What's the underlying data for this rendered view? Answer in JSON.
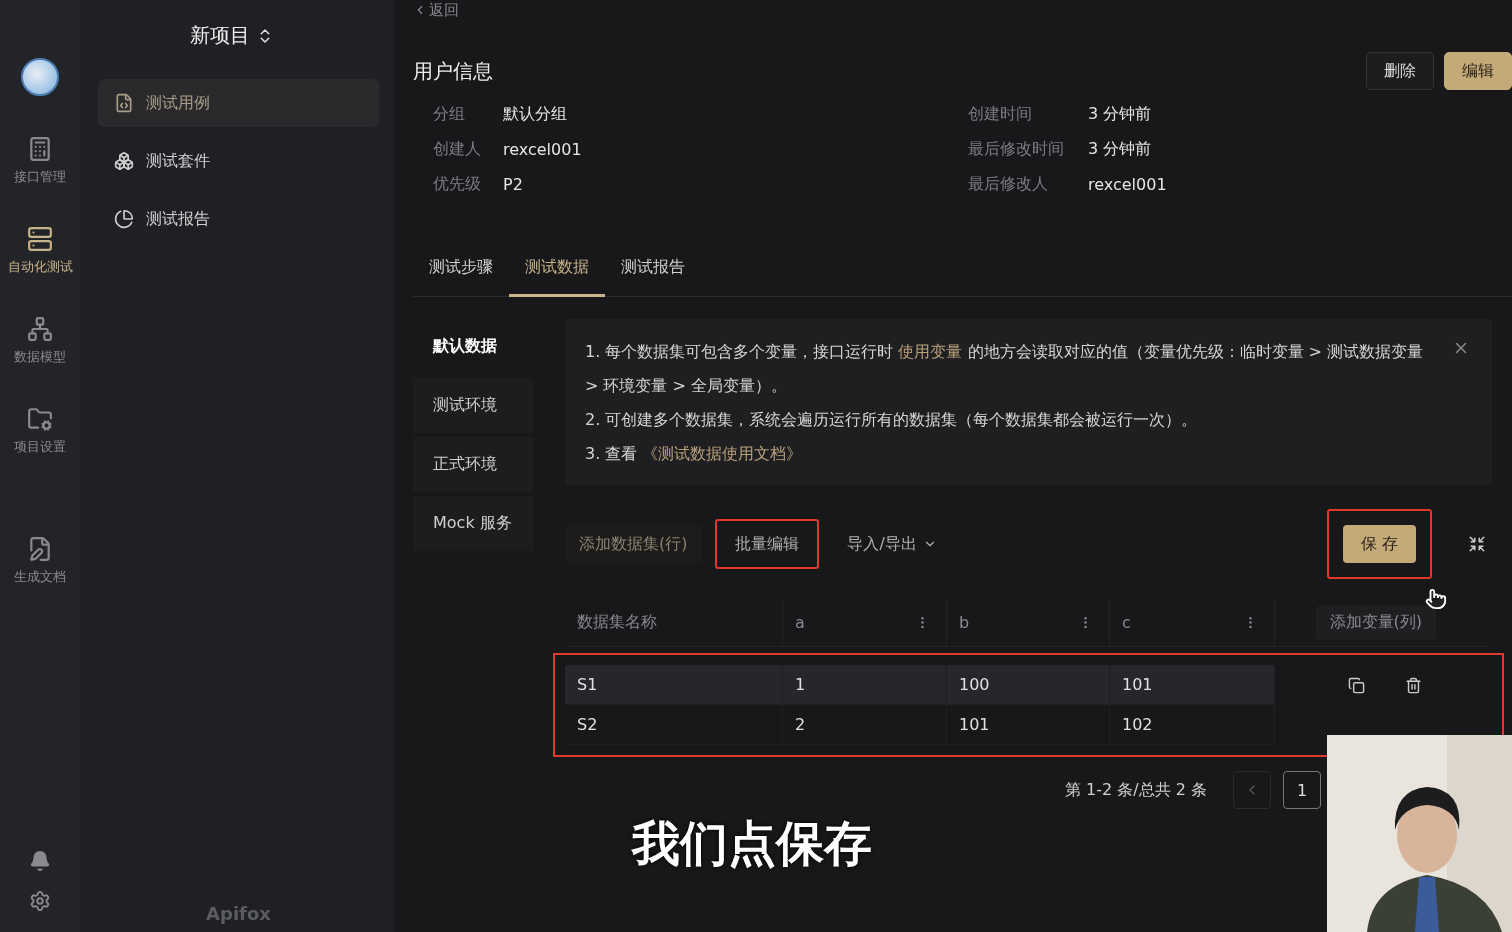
{
  "project": {
    "name": "新项目"
  },
  "rail": [
    {
      "label": "接口管理",
      "selected": false
    },
    {
      "label": "自动化测试",
      "selected": true
    },
    {
      "label": "数据模型",
      "selected": false
    },
    {
      "label": "项目设置",
      "selected": false
    },
    {
      "label": "生成文档",
      "selected": false
    }
  ],
  "nav": [
    {
      "label": "测试用例",
      "selected": true
    },
    {
      "label": "测试套件",
      "selected": false
    },
    {
      "label": "测试报告",
      "selected": false
    }
  ],
  "brand": "Apifox",
  "back": "返回",
  "title": "用户信息",
  "actions": [
    {
      "label": "删除",
      "kind": "secondary"
    },
    {
      "label": "编辑",
      "kind": "primary"
    }
  ],
  "meta_left": [
    {
      "label": "分组",
      "value": "默认分组"
    },
    {
      "label": "创建人",
      "value": "rexcel001"
    },
    {
      "label": "优先级",
      "value": "P2"
    }
  ],
  "meta_right": [
    {
      "label": "创建时间",
      "value": "3 分钟前"
    },
    {
      "label": "最后修改时间",
      "value": "3 分钟前"
    },
    {
      "label": "最后修改人",
      "value": "rexcel001"
    }
  ],
  "tabs": [
    {
      "label": "测试步骤",
      "selected": false
    },
    {
      "label": "测试数据",
      "selected": true
    },
    {
      "label": "测试报告",
      "selected": false
    }
  ],
  "env_tabs": [
    {
      "label": "默认数据",
      "selected": true
    },
    {
      "label": "测试环境",
      "selected": false
    },
    {
      "label": "正式环境",
      "selected": false
    },
    {
      "label": "Mock 服务",
      "selected": false
    }
  ],
  "notice": [
    [
      {
        "kind": "text",
        "text": "1. 每个数据集可包含多个变量，接口运行时 "
      },
      {
        "kind": "link",
        "text": "使用变量"
      },
      {
        "kind": "text",
        "text": " 的地方会读取对应的值（变量优先级：临时变量 > 测试数据变量 > 环境变量 > 全局变量）。"
      }
    ],
    [
      {
        "kind": "text",
        "text": "2. 可创建多个数据集，系统会遍历运行所有的数据集（每个数据集都会被运行一次）。"
      }
    ],
    [
      {
        "kind": "text",
        "text": "3. 查看 "
      },
      {
        "kind": "link",
        "text": "《测试数据使用文档》"
      }
    ]
  ],
  "toolbar": {
    "add_row": "添加数据集(行)",
    "batch_edit": {
      "label": "批量编辑",
      "highlighted": true
    },
    "import_export": "导入/导出",
    "save": {
      "label": "保 存",
      "highlighted": true
    }
  },
  "table": {
    "name_column": "数据集名称",
    "columns": [
      "a",
      "b",
      "c"
    ],
    "add_column": "添加变量(列)",
    "rows_highlighted": true,
    "rows": [
      {
        "name": "S1",
        "cells": [
          "1",
          "100",
          "101"
        ],
        "hovered": true
      },
      {
        "name": "S2",
        "cells": [
          "2",
          "101",
          "102"
        ],
        "hovered": false
      }
    ]
  },
  "pagination": {
    "summary": "第 1-2 条/总共 2 条",
    "pages": [
      {
        "label": "1",
        "selected": true
      }
    ]
  },
  "subtitle": "我们点保存",
  "webcam": {
    "kind": "picture"
  }
}
